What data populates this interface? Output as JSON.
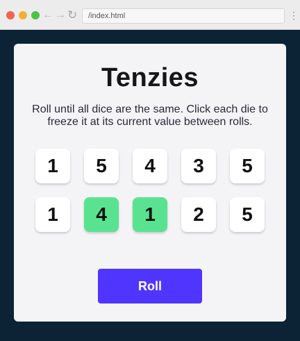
{
  "browser": {
    "url": "/index.html",
    "traffic_colors": [
      "#f0654f",
      "#f5b032",
      "#4fc246"
    ],
    "icons": [
      "back-arrow-icon",
      "forward-arrow-icon",
      "reload-icon",
      "kebab-menu-icon"
    ]
  },
  "game": {
    "title": "Tenzies",
    "instructions": "Roll until all dice are the same. Click each die to freeze it at its current value between rolls.",
    "roll_label": "Roll",
    "held_color": "#59e391",
    "accent_color": "#5035ff",
    "dice": [
      {
        "value": "1",
        "held": false
      },
      {
        "value": "5",
        "held": false
      },
      {
        "value": "4",
        "held": false
      },
      {
        "value": "3",
        "held": false
      },
      {
        "value": "5",
        "held": false
      },
      {
        "value": "1",
        "held": false
      },
      {
        "value": "4",
        "held": true
      },
      {
        "value": "1",
        "held": true
      },
      {
        "value": "2",
        "held": false
      },
      {
        "value": "5",
        "held": false
      }
    ]
  }
}
